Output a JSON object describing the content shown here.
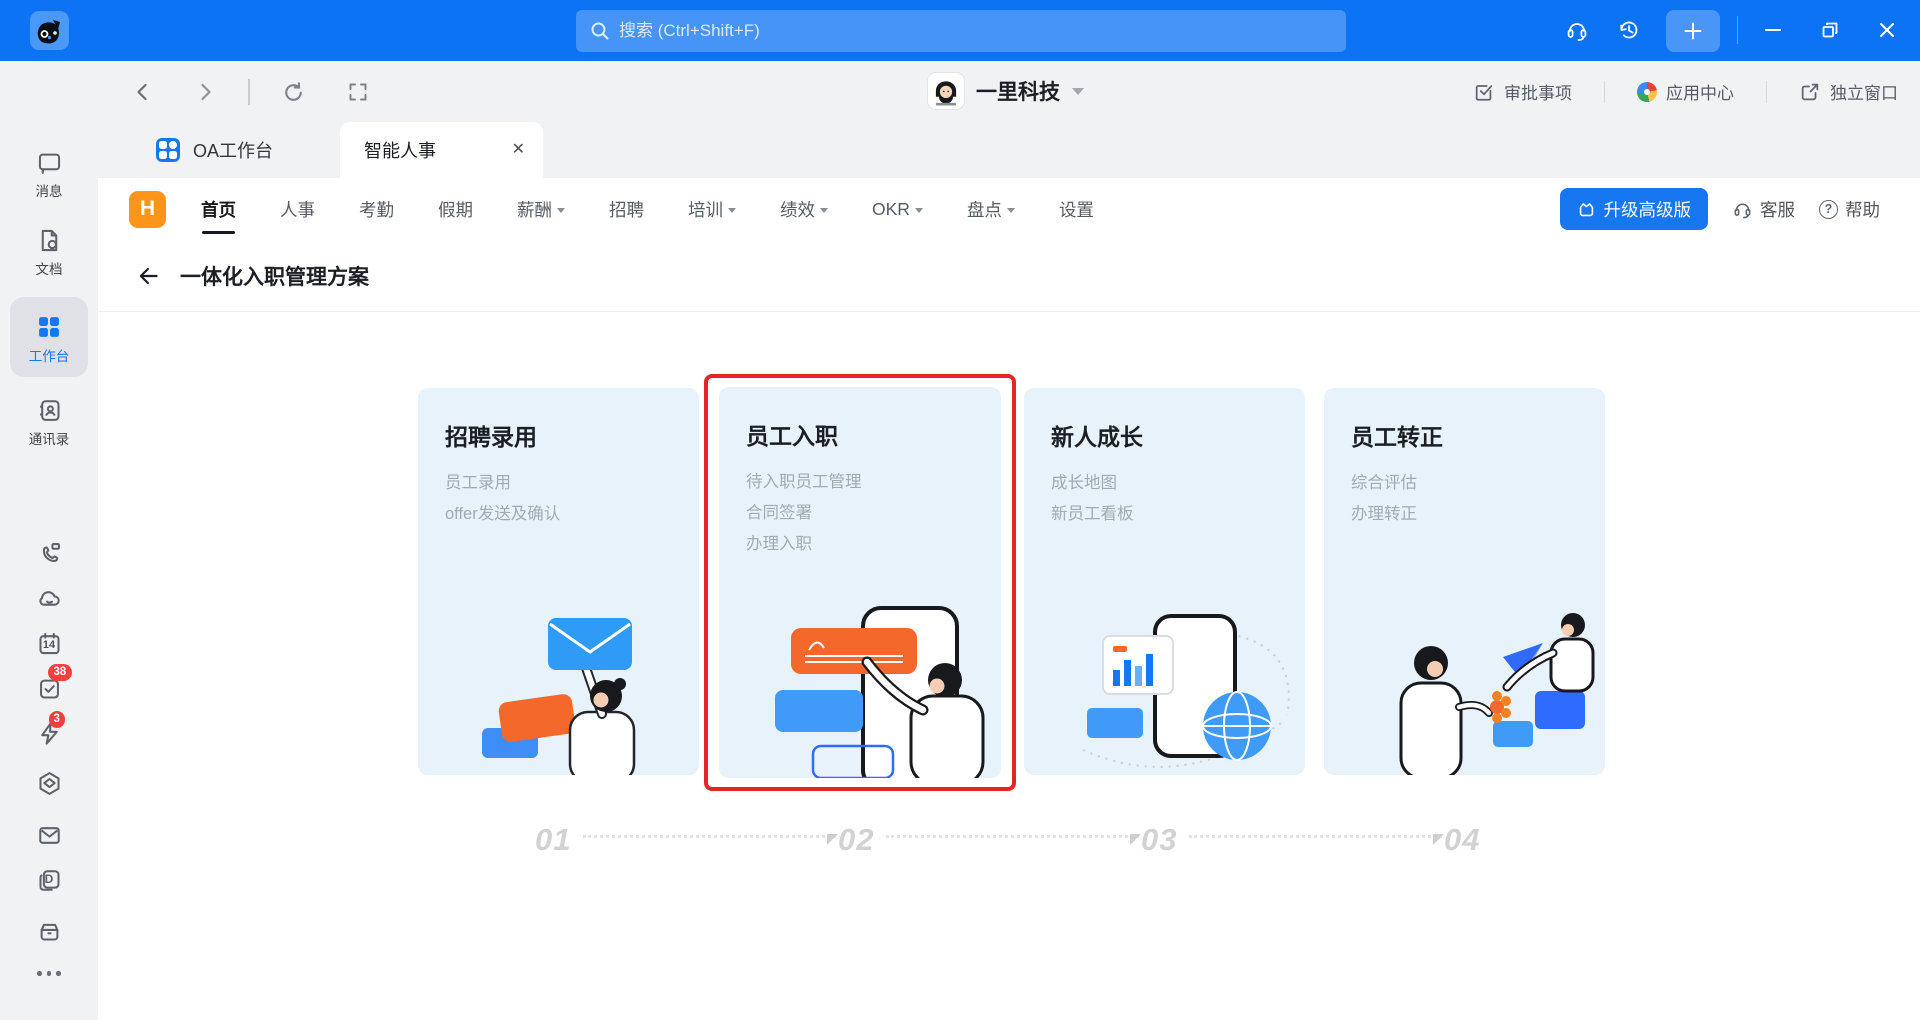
{
  "titlebar": {
    "search_placeholder": "搜索 (Ctrl+Shift+F)"
  },
  "chrome": {
    "org_name": "一里科技",
    "approval_label": "审批事项",
    "app_center_label": "应用中心",
    "standalone_label": "独立窗口"
  },
  "tabs": [
    {
      "label": "OA工作台"
    },
    {
      "label": "智能人事"
    }
  ],
  "nav": {
    "items": [
      {
        "label": "首页"
      },
      {
        "label": "人事"
      },
      {
        "label": "考勤"
      },
      {
        "label": "假期"
      },
      {
        "label": "薪酬"
      },
      {
        "label": "招聘"
      },
      {
        "label": "培训"
      },
      {
        "label": "绩效"
      },
      {
        "label": "OKR"
      },
      {
        "label": "盘点"
      },
      {
        "label": "设置"
      }
    ],
    "upgrade_label": "升级高级版",
    "support_label": "客服",
    "help_label": "帮助"
  },
  "page": {
    "title": "一体化入职管理方案"
  },
  "cards": [
    {
      "step": "01",
      "title": "招聘录用",
      "items": [
        "员工录用",
        "offer发送及确认"
      ]
    },
    {
      "step": "02",
      "title": "员工入职",
      "items": [
        "待入职员工管理",
        "合同签署",
        "办理入职"
      ],
      "highlighted": true
    },
    {
      "step": "03",
      "title": "新人成长",
      "items": [
        "成长地图",
        "新员工看板"
      ]
    },
    {
      "step": "04",
      "title": "员工转正",
      "items": [
        "综合评估",
        "办理转正"
      ]
    }
  ],
  "sidebar": {
    "items": [
      {
        "label": "消息"
      },
      {
        "label": "文档"
      },
      {
        "label": "工作台",
        "active": true
      },
      {
        "label": "通讯录"
      }
    ],
    "calendar_day": "14",
    "todo_badge": "38",
    "flash_badge": "3"
  },
  "brand": {
    "h_logo": "H"
  },
  "icons": {
    "close_tab": "✕",
    "question": "?",
    "docs_letter": "D"
  },
  "colors": {
    "topbar_blue": "#0d73f5",
    "accent_blue": "#1677f5",
    "brand_orange": "#ff9518",
    "highlight_red": "#e52525",
    "card_bg": "#e8f2fb",
    "badge_red": "#f53f3f"
  }
}
